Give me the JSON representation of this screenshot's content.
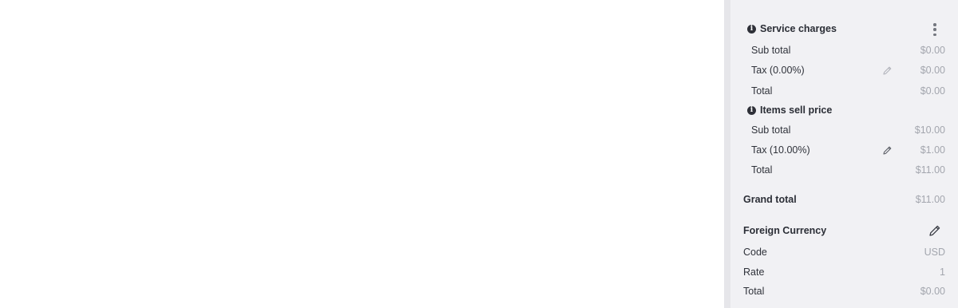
{
  "service_charges": {
    "title": "Service charges",
    "subtotal_label": "Sub total",
    "subtotal_value": "$0.00",
    "tax_label": "Tax (0.00%)",
    "tax_value": "$0.00",
    "total_label": "Total",
    "total_value": "$0.00"
  },
  "items_sell_price": {
    "title": "Items sell price",
    "subtotal_label": "Sub total",
    "subtotal_value": "$10.00",
    "tax_label": "Tax (10.00%)",
    "tax_value": "$1.00",
    "total_label": "Total",
    "total_value": "$11.00"
  },
  "grand_total": {
    "label": "Grand total",
    "value": "$11.00"
  },
  "foreign_currency": {
    "title": "Foreign Currency",
    "code_label": "Code",
    "code_value": "USD",
    "rate_label": "Rate",
    "rate_value": "1",
    "total_label": "Total",
    "total_value": "$0.00"
  },
  "icons": {
    "info": "info-circle-icon",
    "menu": "kebab-menu-icon",
    "edit": "pencil-icon"
  }
}
